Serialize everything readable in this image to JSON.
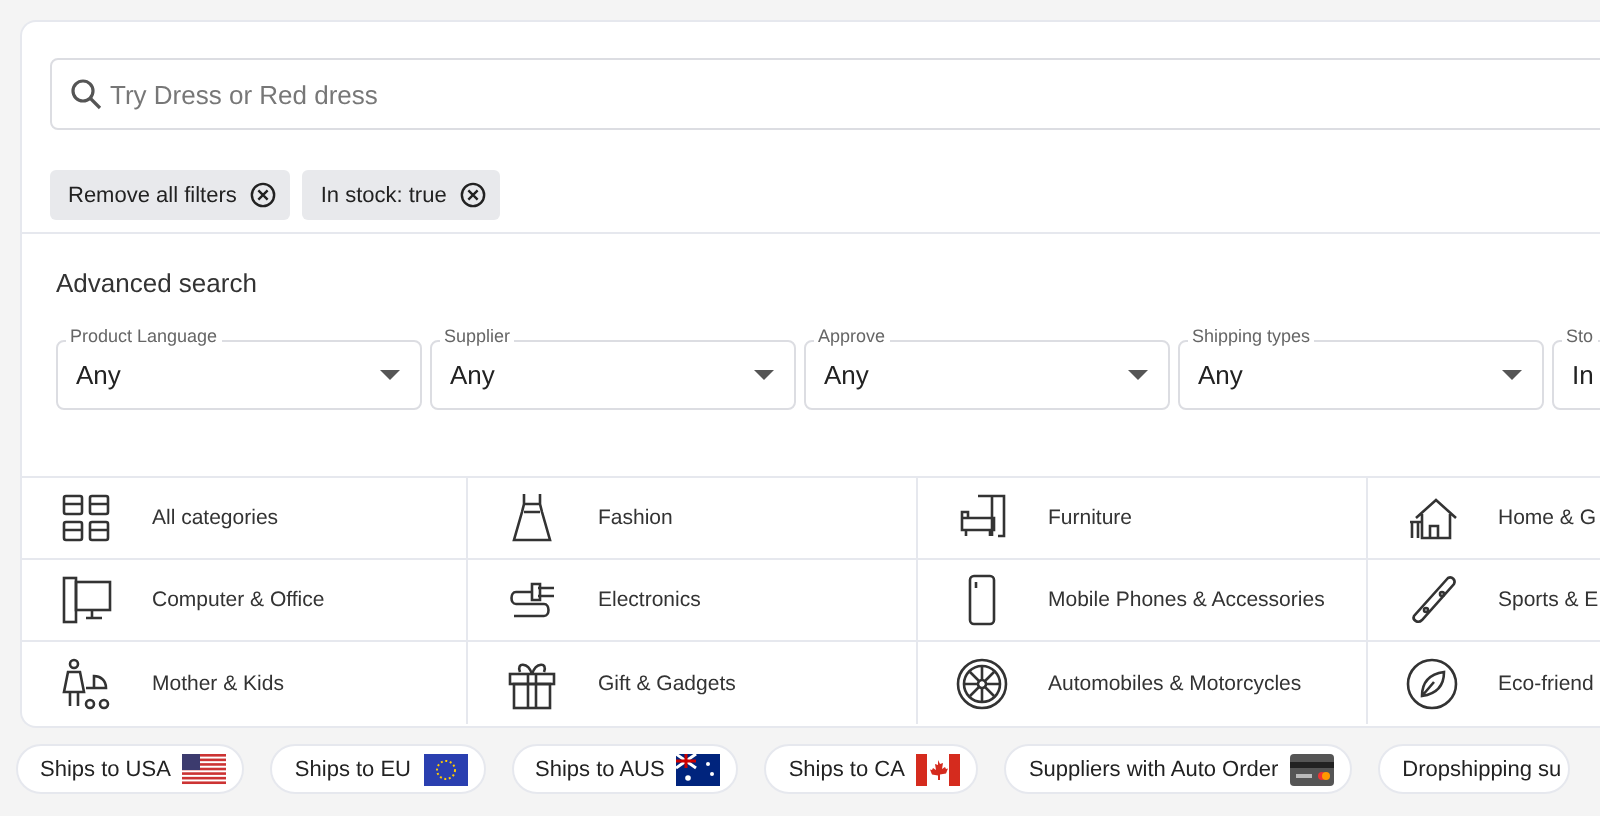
{
  "search": {
    "placeholder": "Try Dress or Red dress"
  },
  "active_filters": [
    {
      "label": "Remove all filters"
    },
    {
      "label": "In stock: true"
    }
  ],
  "advanced_search": {
    "title": "Advanced search",
    "dropdowns": [
      {
        "label": "Product Language",
        "value": "Any"
      },
      {
        "label": "Supplier",
        "value": "Any"
      },
      {
        "label": "Approve",
        "value": "Any"
      },
      {
        "label": "Shipping types",
        "value": "Any"
      },
      {
        "label": "Sto",
        "value": "In"
      }
    ]
  },
  "categories": [
    {
      "label": "All categories",
      "kind": "grid"
    },
    {
      "label": "Fashion",
      "kind": "dress"
    },
    {
      "label": "Furniture",
      "kind": "furniture"
    },
    {
      "label": "Home & G",
      "kind": "house"
    },
    {
      "label": "Computer & Office",
      "kind": "computer"
    },
    {
      "label": "Electronics",
      "kind": "cable"
    },
    {
      "label": "Mobile Phones & Accessories",
      "kind": "phone"
    },
    {
      "label": "Sports & E",
      "kind": "skateboard"
    },
    {
      "label": "Mother & Kids",
      "kind": "stroller"
    },
    {
      "label": "Gift & Gadgets",
      "kind": "gift"
    },
    {
      "label": "Automobiles & Motorcycles",
      "kind": "wheel"
    },
    {
      "label": "Eco-friend",
      "kind": "leaf"
    }
  ],
  "quick_filters": [
    {
      "label": "Ships to USA",
      "kind": "usa"
    },
    {
      "label": "Ships to EU",
      "kind": "eu"
    },
    {
      "label": "Ships to AUS",
      "kind": "aus"
    },
    {
      "label": "Ships to CA",
      "kind": "ca"
    },
    {
      "label": "Suppliers with Auto Order",
      "kind": "card"
    },
    {
      "label": "Dropshipping su",
      "kind": "plain"
    }
  ]
}
